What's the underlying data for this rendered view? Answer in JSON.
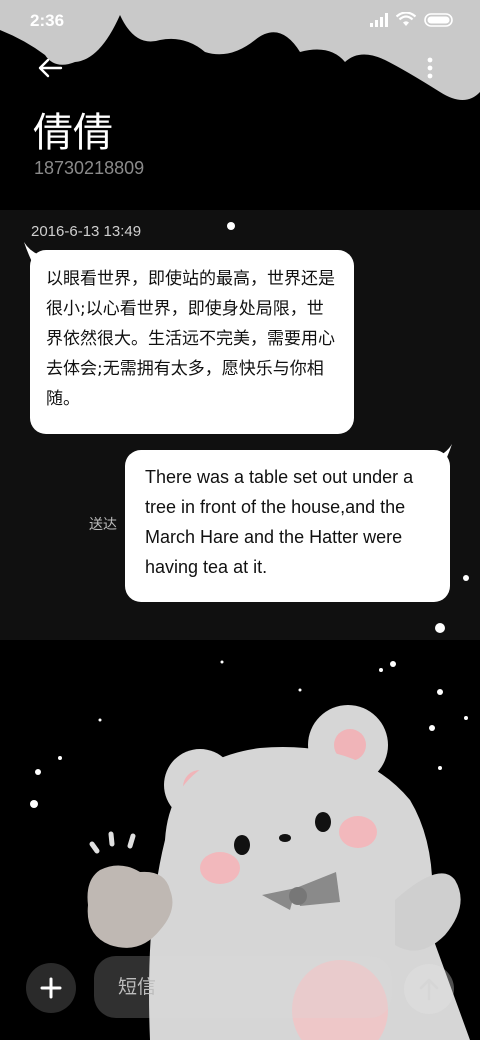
{
  "status_bar": {
    "time": "2:36",
    "icons": [
      "signal-icon",
      "wifi-icon",
      "battery-icon"
    ]
  },
  "header": {
    "back_icon": "arrow-left-icon",
    "more_icon": "more-vertical-icon",
    "contact_name": "倩倩",
    "contact_phone": "18730218809"
  },
  "conversation": {
    "timestamp": "2016-6-13 13:49",
    "incoming_message": "以眼看世界，即使站的最高，世界还是很小;以心看世界，即使身处局限，世界依然很大。生活远不完美，需要用心去体会;无需拥有太多，愿快乐与你相随。",
    "outgoing_message": "There was a table set out under a tree in front of the house,and the March Hare and the Hatter were having tea at it.",
    "outgoing_status": "送达"
  },
  "composer": {
    "add_icon": "plus-icon",
    "placeholder": "短信",
    "send_icon": "arrow-up-icon"
  },
  "colors": {
    "background": "#000000",
    "bubble": "#ffffff",
    "cloud": "#c9c9c9",
    "bear": "#d8d8d8",
    "cheek": "#f2b8bc"
  }
}
